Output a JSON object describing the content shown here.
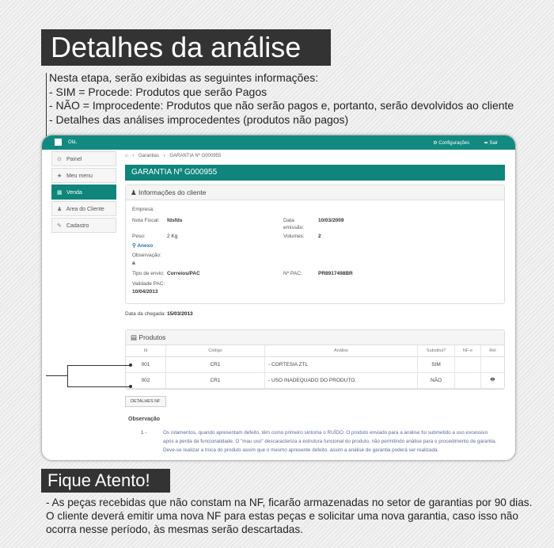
{
  "header": {
    "title": "Detalhes da análise"
  },
  "intro": {
    "lines": [
      "Nesta etapa, serão exibidas as seguintes informações:",
      "- SIM = Procede: Produtos que serão Pagos",
      "- NÃO = Improcedente: Produtos que não serão pagos e, portanto, serão devolvidos ao cliente",
      "- Detalhes das análises improcedentes (produtos não pagos)"
    ]
  },
  "app": {
    "topbar": {
      "greeting": "Olá,",
      "settings": "Configurações",
      "logout": "Sair"
    },
    "sidebar": {
      "items": [
        {
          "label": "Painel",
          "icon": "dashboard-icon"
        },
        {
          "label": "Meu menu",
          "icon": "star-icon"
        },
        {
          "label": "Venda",
          "icon": "cart-icon",
          "active": true
        },
        {
          "label": "Area do Cliente",
          "icon": "user-icon"
        },
        {
          "label": "Cadastro",
          "icon": "edit-icon"
        }
      ]
    },
    "breadcrumb": {
      "items": [
        "Garantias",
        "GARANTIA Nº G000955"
      ]
    },
    "banner": "GARANTIA Nº G000955",
    "client_panel": {
      "title": "Informações do cliente",
      "empresa_label": "Empresa:",
      "nf_label": "Nota Fiscal:",
      "nf_value": "fdsfds",
      "data_emissao_label_1": "Data",
      "data_emissao_label_2": "emissão:",
      "data_emissao_value": "10/03/2009",
      "peso_label": "Peso:",
      "peso_value": "2 Kg",
      "volumes_label": "Volumes:",
      "volumes_value": "2",
      "anexo_label": "Anexo",
      "obs_label": "Observação:",
      "obs_value": "a",
      "envio_label": "Tipo de envio:",
      "envio_value": "Correios/PAC",
      "pac_label": "Nº PAC:",
      "pac_value": "PR8917498BR",
      "validade_label": "Validade PAC:",
      "validade_value": "10/04/2013"
    },
    "chegada_label": "Data da chegada:",
    "chegada_value": "15/03/2013",
    "products": {
      "title": "Produtos",
      "columns": [
        "Id",
        "Código",
        "Análise",
        "Substitui?",
        "NF-e",
        "Rel"
      ],
      "rows": [
        {
          "id": "001",
          "codigo": "CR1",
          "analise": "- CORTESIA ZTL",
          "substitui": "SIM",
          "nfe": "",
          "rel": ""
        },
        {
          "id": "002",
          "codigo": "CR1",
          "analise": "- USO INADEQUADO DO PRODUTO.",
          "substitui": "NÃO",
          "nfe": "",
          "rel": "printer-icon"
        }
      ]
    },
    "details_button": "DETALHES NF",
    "observacao": {
      "title": "Observação",
      "num": "1 -",
      "lines": [
        "Os rolamentos, quando apresentam defeito, têm como primeiro sintoma o RUÍDO. O produto enviado para a análise foi submetido a uso excessivo",
        "após a perda da funcionalidade. O \"mau uso\" descaracteriza a estrutura funcional do produto, não permitindo análise para o procedimento de garantia.",
        "Deve-se realizar a troca do produto assim que o mesmo apresente defeito, assim a análise de garantia poderá ser realizada."
      ]
    }
  },
  "notice": {
    "title": "Fique Atento!",
    "lines": [
      "- As peças recebidas que não constam na NF, ficarão armazenadas no setor de garantias por 90 dias.",
      "O cliente deverá emitir uma nova NF para estas peças e solicitar uma nova garantia, caso isso não",
      "ocorra nesse período, às mesmas serão descartadas."
    ]
  },
  "colors": {
    "accent": "#0f857b",
    "dark_label": "#333333"
  }
}
